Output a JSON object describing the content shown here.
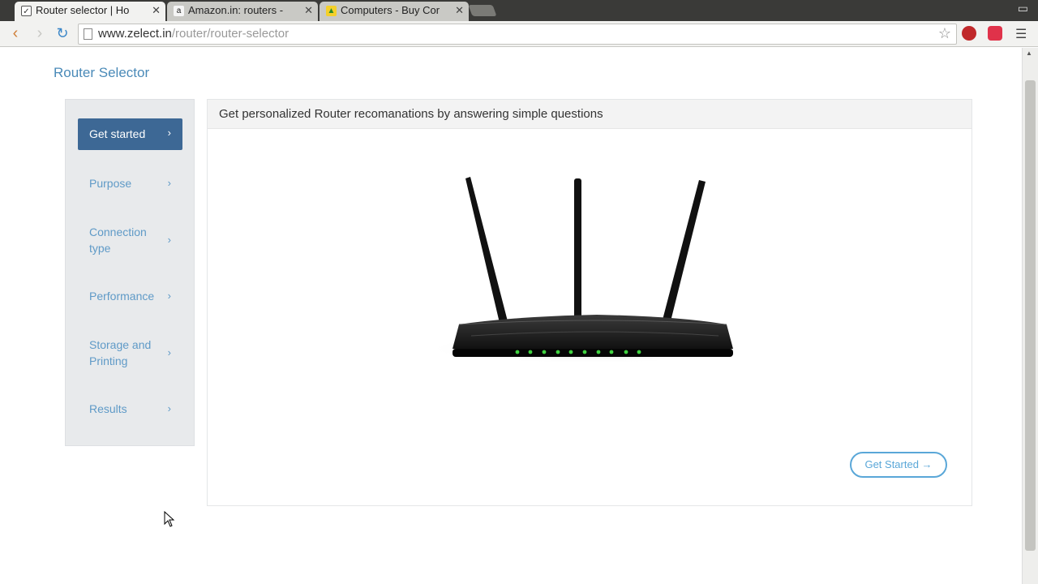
{
  "browser": {
    "tabs": [
      {
        "title": "Router selector | Ho",
        "active": true,
        "favicon": "checkbox-icon"
      },
      {
        "title": "Amazon.in: routers -",
        "active": false,
        "favicon": "amazon-icon"
      },
      {
        "title": "Computers - Buy Cor",
        "active": false,
        "favicon": "bag-icon"
      }
    ],
    "url_host": "www.zelect.in",
    "url_path": "/router/router-selector"
  },
  "page": {
    "title": "Router Selector",
    "steps": [
      {
        "label": "Get started",
        "active": true
      },
      {
        "label": "Purpose",
        "active": false
      },
      {
        "label": "Connection type",
        "active": false
      },
      {
        "label": "Performance",
        "active": false
      },
      {
        "label": "Storage and Printing",
        "active": false
      },
      {
        "label": "Results",
        "active": false
      }
    ],
    "card_title": "Get personalized Router recomanations by answering simple questions",
    "cta_label": "Get Started →"
  },
  "colors": {
    "accent": "#4a8ab8",
    "active_step_bg": "#3d6895",
    "cta_border": "#5aa7d8"
  }
}
